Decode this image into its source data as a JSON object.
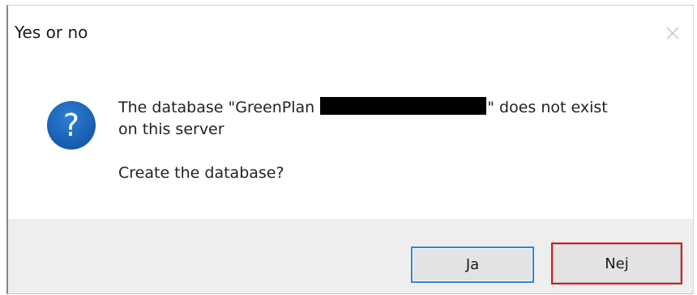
{
  "window": {
    "title": "Yes or no"
  },
  "message": {
    "line1_prefix": "The database \"GreenPlan",
    "line1_suffix": "\" does not exist",
    "line2": "on this server",
    "question": "Create the database?"
  },
  "icons": {
    "dialog_icon": "question-icon",
    "close_icon": "close-icon"
  },
  "buttons": {
    "yes_label": "Ja",
    "no_label": "Nej"
  },
  "colors": {
    "icon_blue": "#1b66b9",
    "focus_blue": "#2e86d6",
    "highlight_red": "#e01818",
    "footer_gray": "#eeeeee"
  }
}
